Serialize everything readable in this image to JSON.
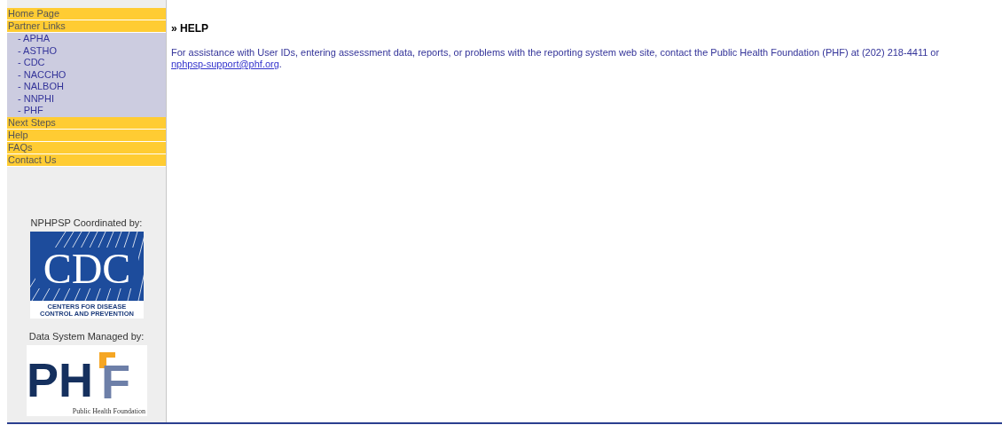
{
  "sidebar": {
    "menu": [
      {
        "label": "Home Page",
        "kind": "main"
      },
      {
        "label": "Partner Links",
        "kind": "main"
      },
      {
        "label": "- APHA",
        "kind": "sub"
      },
      {
        "label": "- ASTHO",
        "kind": "sub"
      },
      {
        "label": "- CDC",
        "kind": "sub"
      },
      {
        "label": "- NACCHO",
        "kind": "sub"
      },
      {
        "label": "- NALBOH",
        "kind": "sub"
      },
      {
        "label": "- NNPHI",
        "kind": "sub"
      },
      {
        "label": "- PHF",
        "kind": "sub"
      },
      {
        "label": "Next Steps",
        "kind": "main"
      },
      {
        "label": "Help",
        "kind": "main"
      },
      {
        "label": "FAQs",
        "kind": "main"
      },
      {
        "label": "Contact Us",
        "kind": "main"
      }
    ],
    "sponsors": [
      {
        "caption": "NPHPSP Coordinated by:",
        "kind": "cdc",
        "logo_text": "CDC",
        "logo_lines": [
          "CENTERS FOR DISEASE",
          "CONTROL AND PREVENTION"
        ]
      },
      {
        "caption": "Data System Managed by:",
        "kind": "phf",
        "logo_text": "PH",
        "logo_letter": "F",
        "logo_lines": [
          "Public Health Foundation"
        ]
      }
    ]
  },
  "main": {
    "heading": "» HELP",
    "paragraph": {
      "text": "For assistance with User IDs, entering  assessment data, reports, or problems with the reporting system web site, contact the Public Health Foundation (PHF) at (202) 218-4411 or ",
      "link": "nphpsp-support@phf.org",
      "tail": "."
    }
  }
}
